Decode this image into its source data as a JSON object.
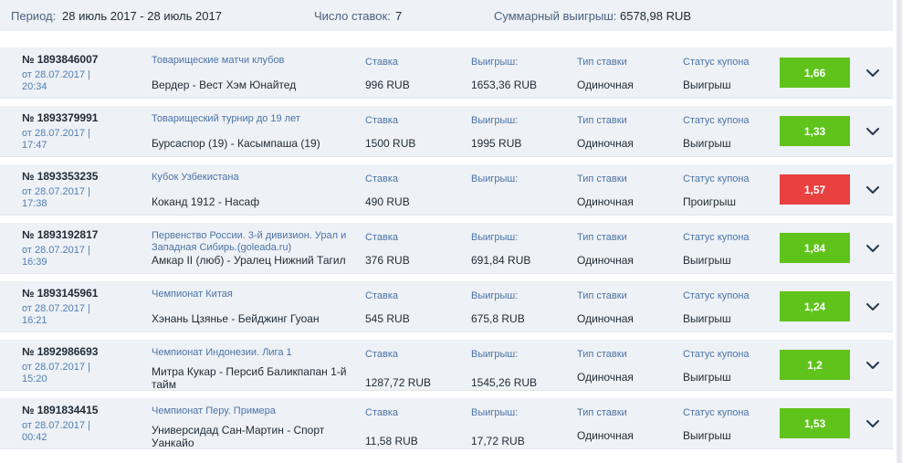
{
  "summary": {
    "period_label": "Период:",
    "period_value": "28 июль 2017 - 28 июль 2017",
    "count_label": "Число ставок:",
    "count_value": "7",
    "total_label": "Суммарный выигрыш:",
    "total_value": "6578,98 RUB"
  },
  "labels": {
    "stake": "Ставка",
    "win": "Выигрыш:",
    "type": "Тип ставки",
    "status": "Статус купона"
  },
  "colors": {
    "win": "#5fc31b",
    "lose": "#e94040",
    "accent": "#4b74a8"
  },
  "coupons": [
    {
      "number": "№ 1893846007",
      "date": "от 28.07.2017 |",
      "time": "20:34",
      "championship": "Товарищеские матчи клубов",
      "match": "Вердер - Вест Хэм Юнайтед",
      "stake": "996 RUB",
      "win": "1653,36 RUB",
      "type": "Одиночная",
      "status": "Выигрыш",
      "odds": "1,66",
      "result": "win"
    },
    {
      "number": "№ 1893379991",
      "date": "от 28.07.2017 |",
      "time": "17:47",
      "championship": "Товарищеский турнир до 19 лет",
      "match": "Бурсаспор (19) - Касымпаша (19)",
      "stake": "1500 RUB",
      "win": "1995 RUB",
      "type": "Одиночная",
      "status": "Выигрыш",
      "odds": "1,33",
      "result": "win"
    },
    {
      "number": "№ 1893353235",
      "date": "от 28.07.2017 |",
      "time": "17:38",
      "championship": "Кубок Узбекистана",
      "match": "Коканд 1912 - Насаф",
      "stake": "490 RUB",
      "win": "",
      "type": "Одиночная",
      "status": "Проигрыш",
      "odds": "1,57",
      "result": "lose"
    },
    {
      "number": "№ 1893192817",
      "date": "от 28.07.2017 |",
      "time": "16:39",
      "championship": "Первенство России. 3-й дивизион. Урал и Западная Сибирь.(goleada.ru)",
      "match": "Амкар II (люб) - Уралец Нижний Тагил",
      "stake": "376 RUB",
      "win": "691,84 RUB",
      "type": "Одиночная",
      "status": "Выигрыш",
      "odds": "1,84",
      "result": "win"
    },
    {
      "number": "№ 1893145961",
      "date": "от 28.07.2017 |",
      "time": "16:21",
      "championship": "Чемпионат Китая",
      "match": "Хэнань Цзянье - Бейджинг Гуоан",
      "stake": "545 RUB",
      "win": "675,8 RUB",
      "type": "Одиночная",
      "status": "Выигрыш",
      "odds": "1,24",
      "result": "win"
    },
    {
      "number": "№ 1892986693",
      "date": "от 28.07.2017 |",
      "time": "15:20",
      "championship": "Чемпионат Индонезии. Лига 1",
      "match": "Митра Кукар - Персиб Баликпапан 1-й тайм",
      "stake": "1287,72 RUB",
      "win": "1545,26 RUB",
      "type": "Одиночная",
      "status": "Выигрыш",
      "odds": "1,2",
      "result": "win"
    },
    {
      "number": "№ 1891834415",
      "date": "от 28.07.2017 |",
      "time": "00:42",
      "championship": "Чемпионат Перу. Примера",
      "match": "Универсидад Сан-Мартин - Спорт Уанкайо",
      "stake": "11,58 RUB",
      "win": "17,72 RUB",
      "type": "Одиночная",
      "status": "Выигрыш",
      "odds": "1,53",
      "result": "win"
    }
  ]
}
